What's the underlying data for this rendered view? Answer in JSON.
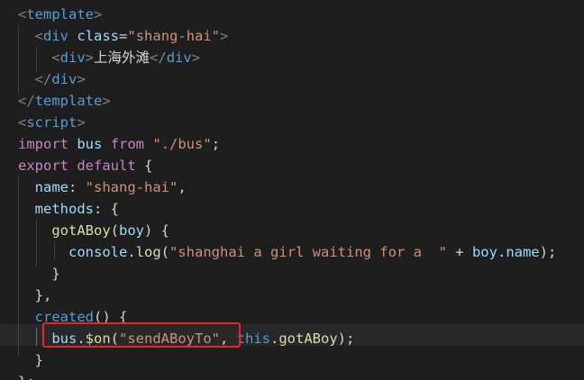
{
  "editor": {
    "theme_colors": {
      "background": "#1e1e1e",
      "tag": "#808080",
      "tag_name": "#569cd6",
      "attribute": "#9cdcfe",
      "string": "#ce9178",
      "keyword": "#c586c0",
      "function": "#dcdcaa",
      "annotation": "#e5262a"
    },
    "lines": [
      {
        "tokens": [
          {
            "t": "tag",
            "v": "<"
          },
          {
            "t": "tagname",
            "v": "template"
          },
          {
            "t": "tag",
            "v": ">"
          }
        ]
      },
      {
        "tokens": [
          {
            "t": "plain",
            "v": "  "
          },
          {
            "t": "tag",
            "v": "<"
          },
          {
            "t": "tagname",
            "v": "div"
          },
          {
            "t": "plain",
            "v": " "
          },
          {
            "t": "attr",
            "v": "class"
          },
          {
            "t": "plain",
            "v": "="
          },
          {
            "t": "str",
            "v": "\"shang-hai\""
          },
          {
            "t": "tag",
            "v": ">"
          }
        ]
      },
      {
        "tokens": [
          {
            "t": "plain",
            "v": "    "
          },
          {
            "t": "tag",
            "v": "<"
          },
          {
            "t": "tagname",
            "v": "div"
          },
          {
            "t": "tag",
            "v": ">"
          },
          {
            "t": "text",
            "v": "上海外滩"
          },
          {
            "t": "tag",
            "v": "</"
          },
          {
            "t": "tagname",
            "v": "div"
          },
          {
            "t": "tag",
            "v": ">"
          }
        ]
      },
      {
        "tokens": [
          {
            "t": "plain",
            "v": "  "
          },
          {
            "t": "tag",
            "v": "</"
          },
          {
            "t": "tagname",
            "v": "div"
          },
          {
            "t": "tag",
            "v": ">"
          }
        ]
      },
      {
        "tokens": [
          {
            "t": "tag",
            "v": "</"
          },
          {
            "t": "tagname",
            "v": "template"
          },
          {
            "t": "tag",
            "v": ">"
          }
        ]
      },
      {
        "tokens": [
          {
            "t": "tag",
            "v": "<"
          },
          {
            "t": "tagname",
            "v": "script"
          },
          {
            "t": "tag",
            "v": ">"
          }
        ]
      },
      {
        "tokens": [
          {
            "t": "kw",
            "v": "import"
          },
          {
            "t": "plain",
            "v": " "
          },
          {
            "t": "var",
            "v": "bus"
          },
          {
            "t": "plain",
            "v": " "
          },
          {
            "t": "kw",
            "v": "from"
          },
          {
            "t": "plain",
            "v": " "
          },
          {
            "t": "str",
            "v": "\"./bus\""
          },
          {
            "t": "plain",
            "v": ";"
          }
        ]
      },
      {
        "tokens": [
          {
            "t": "kw",
            "v": "export"
          },
          {
            "t": "plain",
            "v": " "
          },
          {
            "t": "kw",
            "v": "default"
          },
          {
            "t": "plain",
            "v": " {"
          }
        ]
      },
      {
        "tokens": [
          {
            "t": "plain",
            "v": "  "
          },
          {
            "t": "prop",
            "v": "name"
          },
          {
            "t": "plain",
            "v": ": "
          },
          {
            "t": "str",
            "v": "\"shang-hai\""
          },
          {
            "t": "plain",
            "v": ","
          }
        ]
      },
      {
        "tokens": [
          {
            "t": "plain",
            "v": "  "
          },
          {
            "t": "prop",
            "v": "methods"
          },
          {
            "t": "plain",
            "v": ": {"
          }
        ]
      },
      {
        "tokens": [
          {
            "t": "plain",
            "v": "    "
          },
          {
            "t": "func",
            "v": "gotABoy"
          },
          {
            "t": "plain",
            "v": "("
          },
          {
            "t": "var",
            "v": "boy"
          },
          {
            "t": "plain",
            "v": ") {"
          }
        ]
      },
      {
        "tokens": [
          {
            "t": "plain",
            "v": "      "
          },
          {
            "t": "var",
            "v": "console"
          },
          {
            "t": "plain",
            "v": "."
          },
          {
            "t": "func",
            "v": "log"
          },
          {
            "t": "plain",
            "v": "("
          },
          {
            "t": "str",
            "v": "\"shanghai a girl waiting for a  \""
          },
          {
            "t": "plain",
            "v": " + "
          },
          {
            "t": "var",
            "v": "boy"
          },
          {
            "t": "plain",
            "v": "."
          },
          {
            "t": "prop",
            "v": "name"
          },
          {
            "t": "plain",
            "v": ");"
          }
        ]
      },
      {
        "tokens": [
          {
            "t": "plain",
            "v": "    }"
          }
        ]
      },
      {
        "tokens": [
          {
            "t": "plain",
            "v": "  },"
          }
        ]
      },
      {
        "tokens": [
          {
            "t": "plain",
            "v": "  "
          },
          {
            "t": "kwb",
            "v": "created"
          },
          {
            "t": "plain",
            "v": "() {"
          }
        ]
      },
      {
        "tokens": [
          {
            "t": "plain",
            "v": "    "
          },
          {
            "t": "var",
            "v": "bus"
          },
          {
            "t": "plain",
            "v": "."
          },
          {
            "t": "func",
            "v": "$on"
          },
          {
            "t": "plain",
            "v": "("
          },
          {
            "t": "str",
            "v": "\"sendABoyTo\""
          },
          {
            "t": "plain",
            "v": ", "
          },
          {
            "t": "kwb",
            "v": "this"
          },
          {
            "t": "plain",
            "v": "."
          },
          {
            "t": "func",
            "v": "gotABoy"
          },
          {
            "t": "plain",
            "v": ");"
          }
        ]
      },
      {
        "tokens": [
          {
            "t": "plain",
            "v": "  }"
          }
        ]
      },
      {
        "tokens": [
          {
            "t": "plain",
            "v": "};"
          }
        ]
      }
    ]
  }
}
